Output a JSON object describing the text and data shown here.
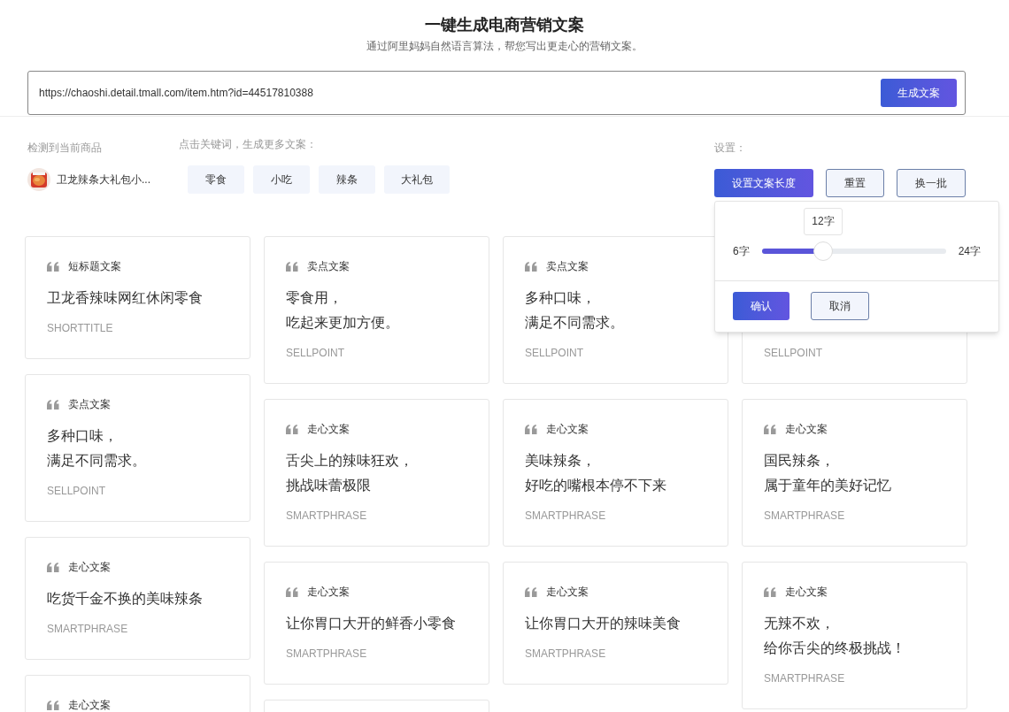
{
  "header": {
    "title": "一键生成电商营销文案",
    "subtitle": "通过阿里妈妈自然语言算法，帮您写出更走心的营销文案。"
  },
  "url_input": {
    "value": "https://chaoshi.detail.tmall.com/item.htm?id=44517810388",
    "button": "生成文案"
  },
  "product": {
    "label": "检测到当前商品",
    "name": "卫龙辣条大礼包小..."
  },
  "keywords": {
    "label": "点击关键词，生成更多文案：",
    "items": [
      "零食",
      "小吃",
      "辣条",
      "大礼包"
    ]
  },
  "settings": {
    "label": "设置：",
    "buttons": [
      {
        "label": "设置文案长度",
        "kind": "primary"
      },
      {
        "label": "重置",
        "kind": "outline"
      },
      {
        "label": "换一批",
        "kind": "outline"
      }
    ]
  },
  "length_popover": {
    "min_label": "6字",
    "max_label": "24字",
    "value_label": "12字",
    "level": 0.333,
    "confirm": "确认",
    "cancel": "取消"
  },
  "columns": [
    [
      {
        "type": "短标题文案",
        "lines": [
          "卫龙香辣味网红休闲零食"
        ],
        "tag": "SHORTTITLE"
      },
      {
        "type": "卖点文案",
        "lines": [
          "多种口味，",
          "满足不同需求。"
        ],
        "tag": "SELLPOINT"
      },
      {
        "type": "走心文案",
        "lines": [
          "吃货千金不换的美味辣条"
        ],
        "tag": "SMARTPHRASE"
      },
      {
        "type": "走心文案"
      }
    ],
    [
      {
        "type": "卖点文案",
        "lines": [
          "零食用，",
          "吃起来更加方便。"
        ],
        "tag": "SELLPOINT"
      },
      {
        "type": "走心文案",
        "lines": [
          "舌尖上的辣味狂欢，",
          "挑战味蕾极限"
        ],
        "tag": "SMARTPHRASE"
      },
      {
        "type": "走心文案",
        "lines": [
          "让你胃口大开的鲜香小零食"
        ],
        "tag": "SMARTPHRASE"
      },
      {}
    ],
    [
      {
        "type": "卖点文案",
        "lines": [
          "多种口味，",
          "满足不同需求。"
        ],
        "tag": "SELLPOINT"
      },
      {
        "type": "走心文案",
        "lines": [
          "美味辣条，",
          "好吃的嘴根本停不下来"
        ],
        "tag": "SMARTPHRASE"
      },
      {
        "type": "走心文案",
        "lines": [
          "让你胃口大开的辣味美食"
        ],
        "tag": "SMARTPHRASE"
      }
    ],
    [
      {
        "tag": "SELLPOINT"
      },
      {
        "type": "走心文案",
        "lines": [
          "国民辣条，",
          "属于童年的美好记忆"
        ],
        "tag": "SMARTPHRASE"
      },
      {
        "type": "走心文案",
        "lines": [
          "无辣不欢，",
          "给你舌尖的终极挑战！"
        ],
        "tag": "SMARTPHRASE"
      }
    ]
  ]
}
